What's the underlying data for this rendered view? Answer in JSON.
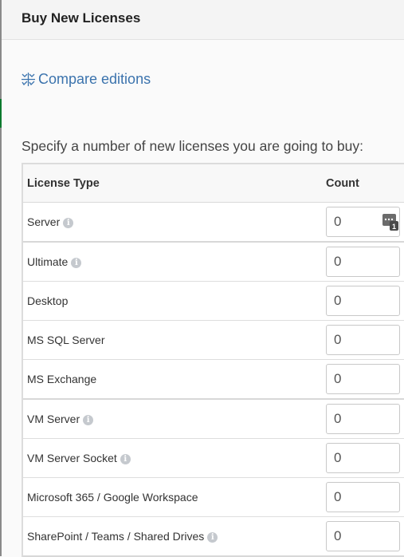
{
  "header": {
    "title": "Buy New Licenses"
  },
  "compare": {
    "label": "Compare editions",
    "icon": "compare-icon"
  },
  "instructions": "Specify a number of new licenses you are going to buy:",
  "table": {
    "columns": {
      "type": "License Type",
      "count": "Count"
    },
    "rows": [
      {
        "label": "Server",
        "info": true,
        "count": "0"
      },
      {
        "label": "Ultimate",
        "info": true,
        "count": "0"
      },
      {
        "label": "Desktop",
        "info": false,
        "count": "0"
      },
      {
        "label": "MS SQL Server",
        "info": false,
        "count": "0"
      },
      {
        "label": "MS Exchange",
        "info": false,
        "count": "0"
      },
      {
        "label": "VM Server",
        "info": true,
        "count": "0"
      },
      {
        "label": "VM Server Socket",
        "info": true,
        "count": "0"
      },
      {
        "label": "Microsoft 365 / Google Workspace",
        "info": false,
        "count": "0"
      },
      {
        "label": "SharePoint / Teams / Shared Drives",
        "info": true,
        "count": "0"
      }
    ]
  },
  "info_glyph": "i",
  "colors": {
    "link": "#3b73ad",
    "accent": "#0b7a2e"
  }
}
